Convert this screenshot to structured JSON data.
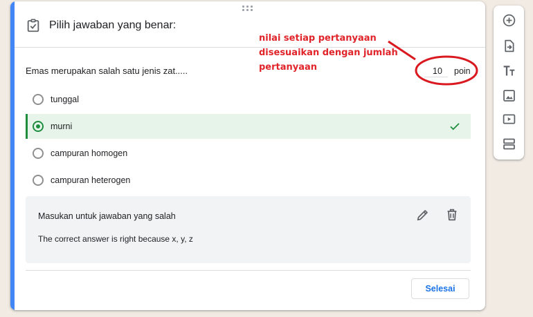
{
  "question_card": {
    "header_title": "Pilih jawaban yang benar:",
    "question": "Emas merupakan salah satu jenis zat.....",
    "points": {
      "value": "10",
      "unit": "poin"
    },
    "options": [
      {
        "label": "tunggal",
        "selected": false
      },
      {
        "label": "murni",
        "selected": true,
        "correct": true
      },
      {
        "label": "campuran homogen",
        "selected": false
      },
      {
        "label": "campuran heterogen",
        "selected": false
      }
    ],
    "feedback": {
      "title": "Masukan untuk jawaban yang salah",
      "body": "The correct answer is right because x, y, z"
    },
    "done_label": "Selesai"
  },
  "side_toolbar": {
    "icons": [
      "add-question-icon",
      "import-questions-icon",
      "add-title-icon",
      "add-image-icon",
      "add-video-icon",
      "add-section-icon"
    ]
  },
  "annotation": {
    "text_lines": [
      "nilai setiap pertanyaan",
      "disesuaikan dengan jumlah",
      "pertanyaan"
    ]
  },
  "colors": {
    "accent": "#4285f4",
    "correct_green": "#1e8e3e",
    "selected_bg": "#e6f4ea",
    "button_blue": "#1a73e8",
    "annotation_red": "#e0242a",
    "page_bg": "#f1ebe4"
  }
}
